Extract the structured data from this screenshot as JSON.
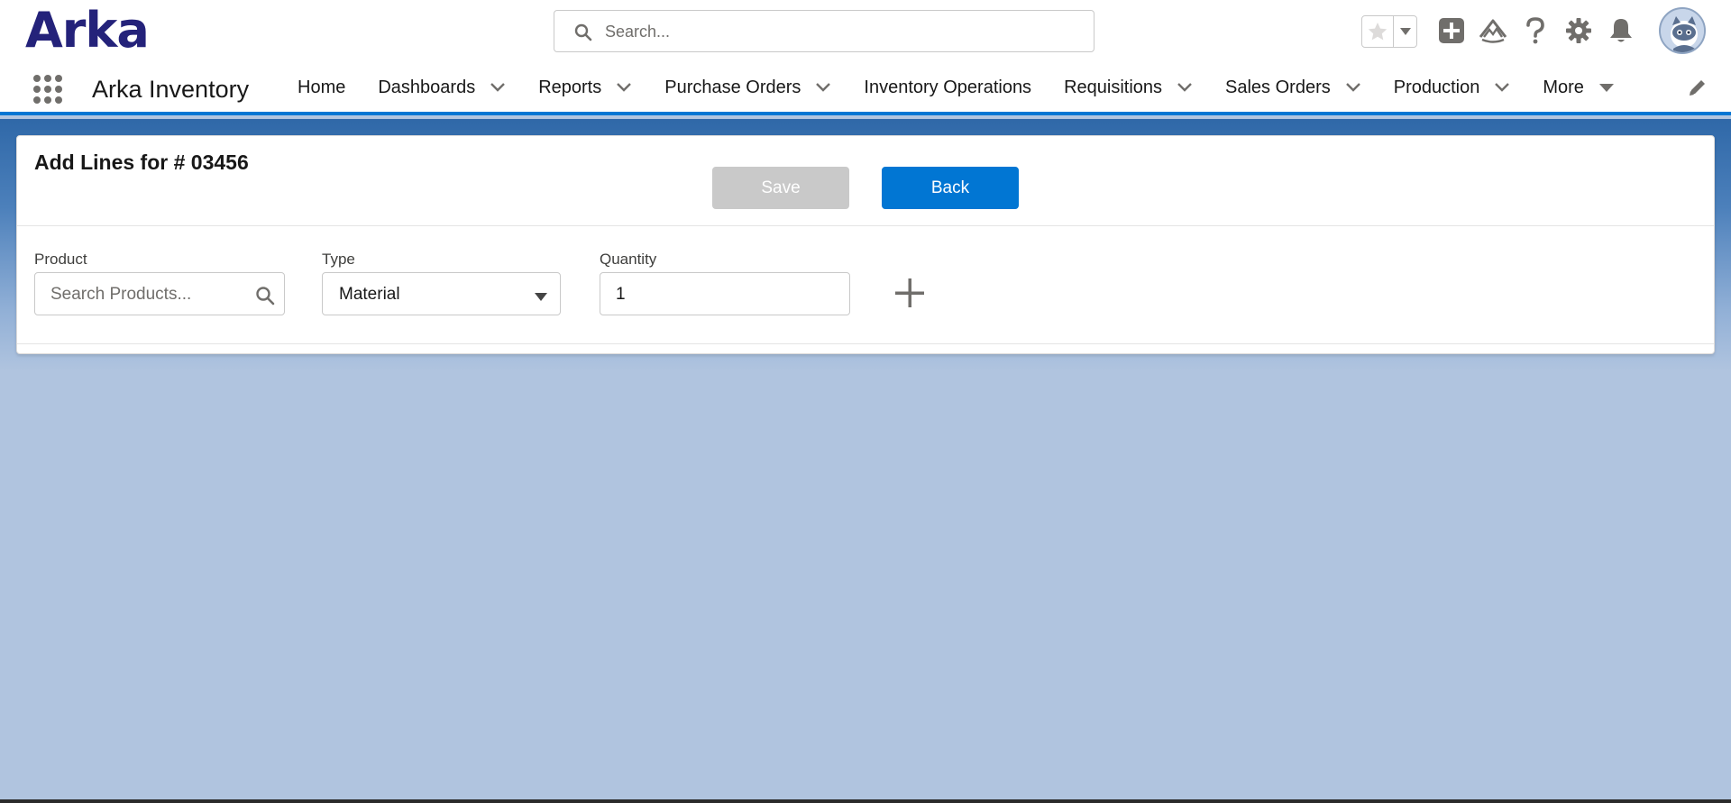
{
  "header": {
    "logo": "Arka",
    "search_placeholder": "Search..."
  },
  "nav": {
    "app_name": "Arka Inventory",
    "items": [
      {
        "label": "Home",
        "has_dropdown": false
      },
      {
        "label": "Dashboards",
        "has_dropdown": true
      },
      {
        "label": "Reports",
        "has_dropdown": true
      },
      {
        "label": "Purchase Orders",
        "has_dropdown": true
      },
      {
        "label": "Inventory Operations",
        "has_dropdown": false
      },
      {
        "label": "Requisitions",
        "has_dropdown": true
      },
      {
        "label": "Sales Orders",
        "has_dropdown": true
      },
      {
        "label": "Production",
        "has_dropdown": true
      },
      {
        "label": "More",
        "has_dropdown": true
      }
    ]
  },
  "card": {
    "title": "Add Lines for # 03456",
    "save_label": "Save",
    "back_label": "Back",
    "fields": {
      "product": {
        "label": "Product",
        "placeholder": "Search Products..."
      },
      "type": {
        "label": "Type",
        "value": "Material"
      },
      "quantity": {
        "label": "Quantity",
        "value": "1"
      }
    }
  },
  "colors": {
    "brand": "#24227a",
    "accent": "#0176d3",
    "disabled": "#c9c9c9",
    "background": "#b0c4df"
  }
}
